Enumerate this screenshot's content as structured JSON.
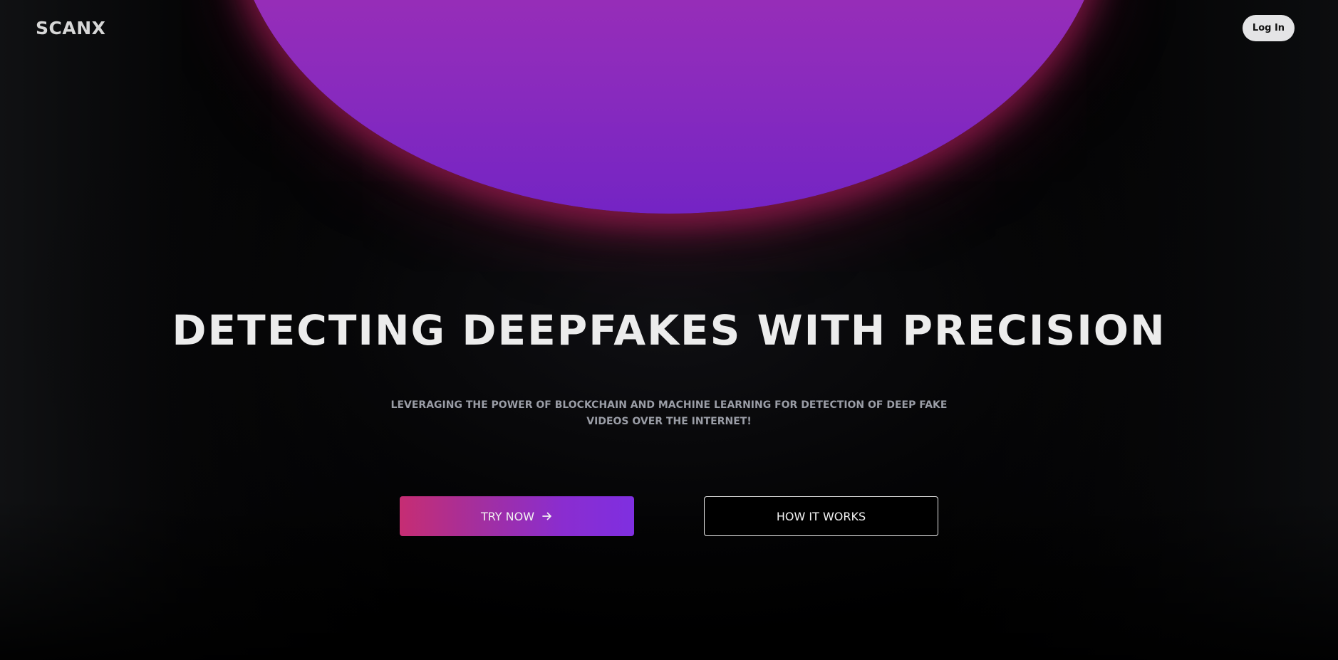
{
  "brand": {
    "logo_text": "SCANX"
  },
  "header": {
    "login_label": "Log In"
  },
  "hero": {
    "title": "DETECTING DEEPFAKES WITH PRECISION",
    "subtitle": "LEVERAGING THE POWER OF BLOCKCHAIN AND MACHINE LEARNING FOR DETECTION OF DEEP FAKE VIDEOS OVER THE INTERNET!"
  },
  "actions": {
    "try_now_label": "TRY NOW",
    "try_now_icon": "arrow-right-icon",
    "how_it_works_label": "HOW IT WORKS"
  },
  "colors": {
    "background": "#000000",
    "orb_top": "#b535ad",
    "orb_bottom": "#7424c4",
    "glow": "#aa1e5a",
    "cta_gradient_start": "#c62d73",
    "cta_gradient_end": "#7f2fe0",
    "login_bg": "#e4e4e6",
    "subtitle_text": "#9a9da6"
  }
}
